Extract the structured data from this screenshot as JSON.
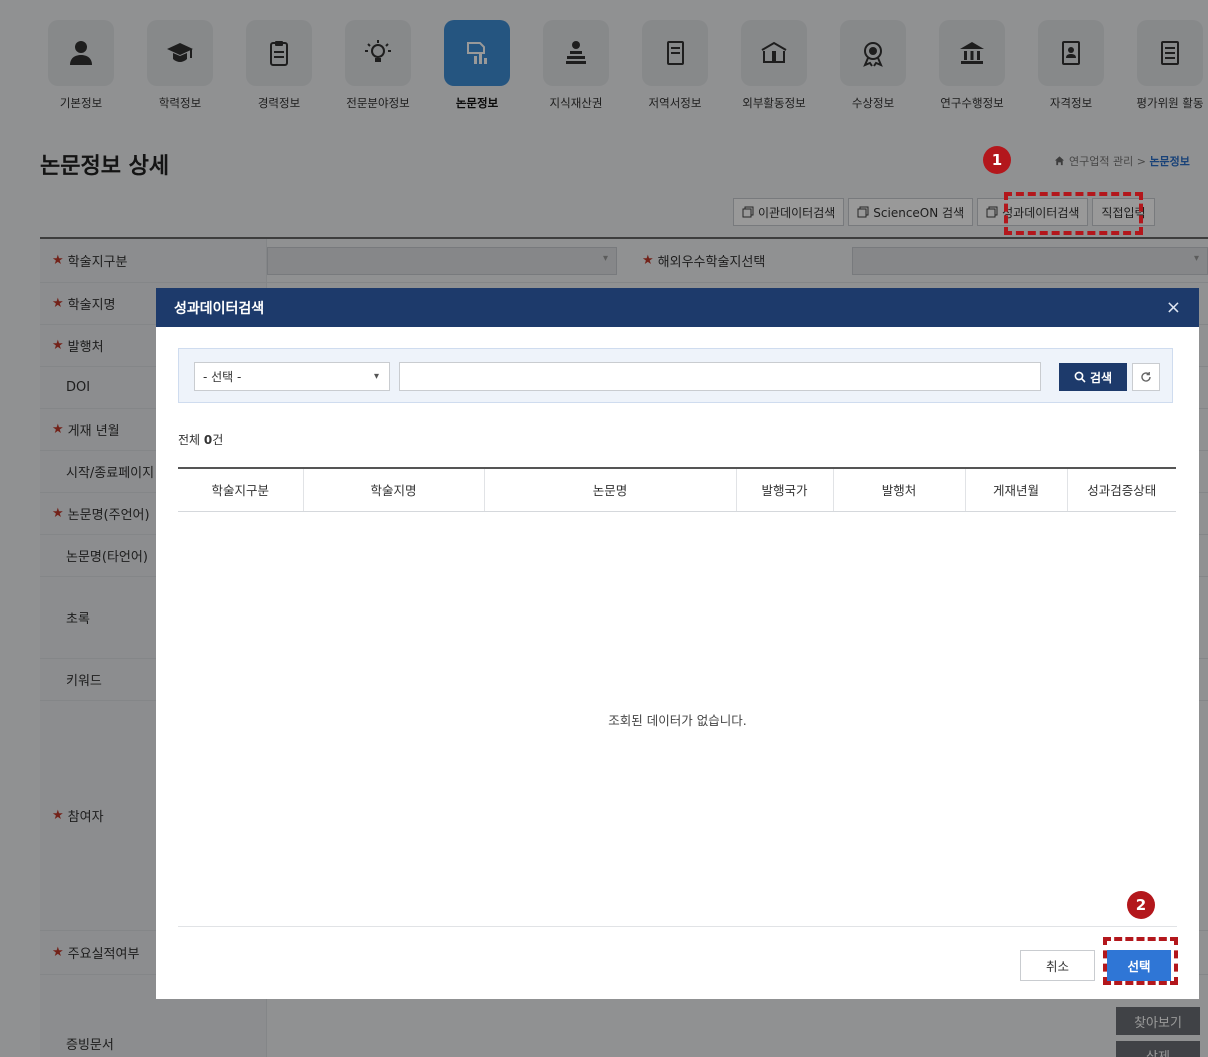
{
  "nav": {
    "items": [
      {
        "label": "기본정보",
        "icon": "person-icon"
      },
      {
        "label": "학력정보",
        "icon": "graduation-cap-icon"
      },
      {
        "label": "경력정보",
        "icon": "clipboard-icon"
      },
      {
        "label": "전문분야정보",
        "icon": "lightbulb-icon"
      },
      {
        "label": "논문정보",
        "icon": "paper-chart-icon",
        "active": true
      },
      {
        "label": "지식재산권",
        "icon": "books-person-icon"
      },
      {
        "label": "저역서정보",
        "icon": "book-icon"
      },
      {
        "label": "외부활동정보",
        "icon": "open-book-icon"
      },
      {
        "label": "수상정보",
        "icon": "award-icon"
      },
      {
        "label": "연구수행정보",
        "icon": "institution-icon"
      },
      {
        "label": "자격정보",
        "icon": "id-card-icon"
      },
      {
        "label": "평가위원 활동",
        "icon": "document-list-icon"
      }
    ]
  },
  "page": {
    "title": "논문정보 상세",
    "breadcrumb": {
      "parent": "연구업적 관리",
      "separator": ">",
      "current": "논문정보"
    }
  },
  "toolbar": {
    "transfer_search": "이관데이터검색",
    "scienceon_search": "ScienceON 검색",
    "performance_search": "성과데이터검색",
    "direct_input": "직접입력"
  },
  "annotations": {
    "step1": "1",
    "step2": "2"
  },
  "form": {
    "journal_type_label": "학술지구분",
    "overseas_journal_label": "해외우수학술지선택",
    "journal_name_label": "학술지명",
    "publisher_label": "발행처",
    "doi_label": "DOI",
    "publish_year_label": "게재 년월",
    "page_range_label": "시작/종료페이지",
    "title_main_label": "논문명(주언어)",
    "title_other_label": "논문명(타언어)",
    "abstract_label": "초록",
    "keyword_label": "키워드",
    "participants_label": "참여자",
    "main_achievement_label": "주요실적여부",
    "evidence_label": "증빙문서",
    "browse_button": "찾아보기",
    "delete_button": "삭제"
  },
  "modal": {
    "title": "성과데이터검색",
    "close_icon": "×",
    "search": {
      "select_value": "- 선택 -",
      "input_value": "",
      "search_button": "검색",
      "reset_icon": "refresh-icon"
    },
    "total": {
      "prefix": "전체 ",
      "count": "0",
      "suffix": "건"
    },
    "table": {
      "columns": [
        "학술지구분",
        "학술지명",
        "논문명",
        "발행국가",
        "발행처",
        "게재년월",
        "성과검증상태"
      ]
    },
    "empty_message": "조회된 데이터가 없습니다.",
    "cancel_button": "취소",
    "select_button": "선택"
  },
  "colors": {
    "accent": "#3f8ed6",
    "modal_header": "#1d3a6b",
    "primary_button": "#2f76d6",
    "highlight": "#b3171c",
    "required": "#c0392b"
  }
}
